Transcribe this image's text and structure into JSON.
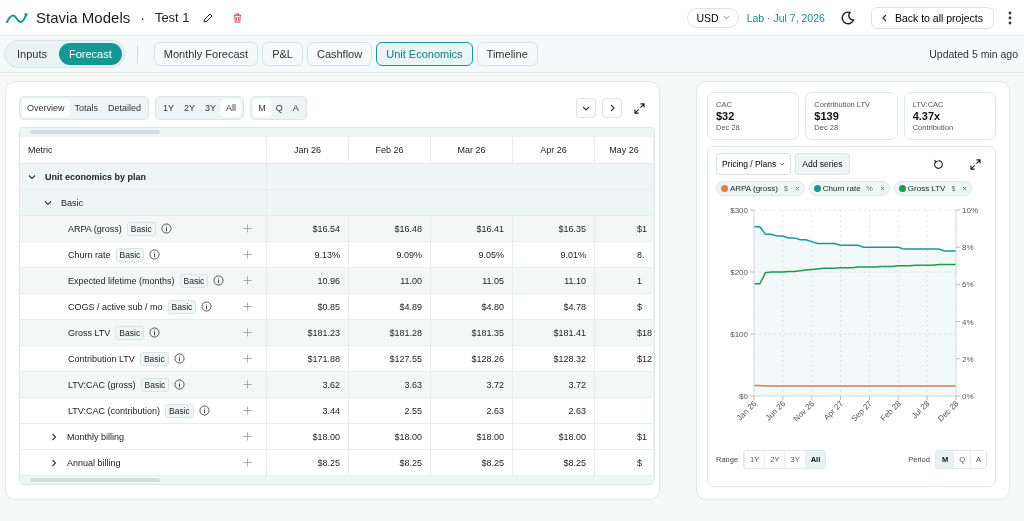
{
  "header": {
    "app_name": "Stavia Models",
    "separator": "·",
    "project": "Test 1",
    "currency": "USD",
    "environment": "Lab · Jul 7, 2026",
    "back_button": "Back to all projects"
  },
  "mode_tabs": [
    {
      "label": "Inputs",
      "selected": false
    },
    {
      "label": "Forecast",
      "selected": true
    }
  ],
  "view_tabs": [
    {
      "label": "Monthly Forecast",
      "selected": false
    },
    {
      "label": "P&L",
      "selected": false
    },
    {
      "label": "Cashflow",
      "selected": false
    },
    {
      "label": "Unit Economics",
      "selected": true
    },
    {
      "label": "Timeline",
      "selected": false
    }
  ],
  "updated": "Updated 5 min ago",
  "table_panel": {
    "view_options": [
      {
        "label": "Overview",
        "selected": true
      },
      {
        "label": "Totals",
        "selected": false
      },
      {
        "label": "Detailed",
        "selected": false
      }
    ],
    "range_options": [
      {
        "label": "1Y",
        "selected": false
      },
      {
        "label": "2Y",
        "selected": false
      },
      {
        "label": "3Y",
        "selected": false
      },
      {
        "label": "All",
        "selected": true
      }
    ],
    "period_options": [
      {
        "label": "M",
        "selected": true
      },
      {
        "label": "Q",
        "selected": false
      },
      {
        "label": "A",
        "selected": false
      }
    ],
    "table": {
      "columns": [
        "Metric",
        "Jan 26",
        "Feb 26",
        "Mar 26",
        "Apr 26",
        "May 26"
      ],
      "rows": [
        {
          "label": "Unit economics by plan",
          "kind": "group",
          "expanded": true,
          "children": [
            {
              "label": "Basic",
              "kind": "group",
              "expanded": true,
              "children": [
                {
                  "label": "ARPA (gross)",
                  "kind": "metric",
                  "badge": "Basic",
                  "values": [
                    "$16.54",
                    "$16.48",
                    "$16.41",
                    "$16.35",
                    "$1"
                  ]
                },
                {
                  "label": "Churn rate",
                  "kind": "metric",
                  "badge": "Basic",
                  "values": [
                    "9.13%",
                    "9.09%",
                    "9.05%",
                    "9.01%",
                    "8."
                  ]
                },
                {
                  "label": "Expected lifetime (months)",
                  "kind": "metric",
                  "badge": "Basic",
                  "values": [
                    "10.96",
                    "11.00",
                    "11.05",
                    "11.10",
                    "1"
                  ]
                },
                {
                  "label": "COGS / active sub / mo",
                  "kind": "metric",
                  "badge": "Basic",
                  "values": [
                    "$0.85",
                    "$4.89",
                    "$4.80",
                    "$4.78",
                    "$"
                  ]
                },
                {
                  "label": "Gross LTV",
                  "kind": "metric",
                  "badge": "Basic",
                  "values": [
                    "$181.23",
                    "$181.28",
                    "$181.35",
                    "$181.41",
                    "$18"
                  ]
                },
                {
                  "label": "Contribution LTV",
                  "kind": "metric",
                  "badge": "Basic",
                  "values": [
                    "$171.88",
                    "$127.55",
                    "$128.26",
                    "$128.32",
                    "$12"
                  ]
                },
                {
                  "label": "LTV:CAC (gross)",
                  "kind": "metric",
                  "badge": "Basic",
                  "values": [
                    "3.62",
                    "3.63",
                    "3.72",
                    "3.72"
                  ]
                },
                {
                  "label": "LTV:CAC (contribution)",
                  "kind": "metric",
                  "badge": "Basic",
                  "values": [
                    "3.44",
                    "2.55",
                    "2.63",
                    "2.63"
                  ]
                }
              ]
            },
            {
              "label": "Monthly billing",
              "kind": "plan",
              "expanded": false,
              "values": [
                "$18.00",
                "$18.00",
                "$18.00",
                "$18.00",
                "$1"
              ]
            },
            {
              "label": "Annual billing",
              "kind": "plan",
              "expanded": false,
              "values": [
                "$8.25",
                "$8.25",
                "$8.25",
                "$8.25",
                "$"
              ]
            }
          ]
        }
      ]
    }
  },
  "kpis": [
    {
      "label": "CAC",
      "value": "$32",
      "note": "Dec 28"
    },
    {
      "label": "Contribution LTV",
      "value": "$139",
      "note": "Dec 28"
    },
    {
      "label": "LTV:CAC",
      "value": "4.37x",
      "note": "Contribution"
    }
  ],
  "chart_panel": {
    "dimension": "Pricing / Plans",
    "add_series": "Add series",
    "series_units": [
      "$",
      "%",
      "$"
    ],
    "chart_data": {
      "type": "line",
      "grid": true,
      "categories": [
        "Jan 26",
        null,
        null,
        null,
        null,
        "Jun 26",
        null,
        null,
        null,
        null,
        "Nov 26",
        null,
        null,
        null,
        null,
        "Apr 27",
        null,
        null,
        null,
        null,
        "Sep 27",
        null,
        null,
        null,
        null,
        "Feb 28",
        null,
        null,
        null,
        null,
        "Jul 28",
        null,
        null,
        null,
        null,
        "Dec 28"
      ],
      "ylim": [
        0,
        300
      ],
      "yticks": [
        {
          "value": 0,
          "label": "$0"
        },
        {
          "value": 100,
          "label": "$100"
        },
        {
          "value": 200,
          "label": "$200"
        },
        {
          "value": 300,
          "label": "$300"
        }
      ],
      "y2lim": [
        0,
        10
      ],
      "y2ticks": [
        {
          "value": 0,
          "label": "0%"
        },
        {
          "value": 2,
          "label": "2%"
        },
        {
          "value": 4,
          "label": "4%"
        },
        {
          "value": 6,
          "label": "6%"
        },
        {
          "value": 8,
          "label": "8%"
        },
        {
          "value": 10,
          "label": "10%"
        }
      ],
      "series": [
        {
          "name": "ARPA (gross)",
          "color": "#f07a45",
          "values": [
            17,
            17,
            16,
            16,
            16,
            16,
            16,
            16,
            16,
            16,
            16,
            16,
            16,
            16,
            16,
            16,
            16,
            16,
            16,
            16,
            16,
            16,
            16,
            16,
            16,
            16,
            16,
            16,
            16,
            16,
            16,
            16,
            16,
            16,
            16,
            16
          ]
        },
        {
          "name": "Churn rate",
          "color": "#15999a",
          "axis": "y2",
          "values": [
            9.1,
            9.1,
            8.7,
            8.7,
            8.6,
            8.6,
            8.5,
            8.5,
            8.4,
            8.4,
            8.3,
            8.2,
            8.2,
            8.2,
            8.2,
            8.1,
            8.1,
            8.1,
            8.1,
            8.0,
            8.0,
            8.0,
            8.0,
            8.0,
            8.0,
            8.0,
            7.9,
            7.9,
            7.9,
            7.9,
            7.9,
            7.9,
            7.9,
            7.8,
            7.8,
            7.8
          ]
        },
        {
          "name": "Gross LTV",
          "color": "#1e9a4a",
          "values": [
            181,
            181,
            199,
            200,
            200,
            200,
            201,
            201,
            202,
            203,
            204,
            205,
            206,
            206,
            206,
            207,
            207,
            207,
            208,
            208,
            208,
            208,
            209,
            209,
            209,
            210,
            210,
            210,
            211,
            211,
            211,
            211,
            212,
            212,
            212,
            212
          ]
        }
      ]
    },
    "range_label": "Range",
    "range_options": [
      {
        "label": "1Y",
        "selected": false
      },
      {
        "label": "2Y",
        "selected": false
      },
      {
        "label": "3Y",
        "selected": false
      },
      {
        "label": "All",
        "selected": true
      }
    ],
    "period_label": "Period",
    "period_options": [
      {
        "label": "M",
        "selected": true
      },
      {
        "label": "Q",
        "selected": false
      },
      {
        "label": "A",
        "selected": false
      }
    ]
  }
}
